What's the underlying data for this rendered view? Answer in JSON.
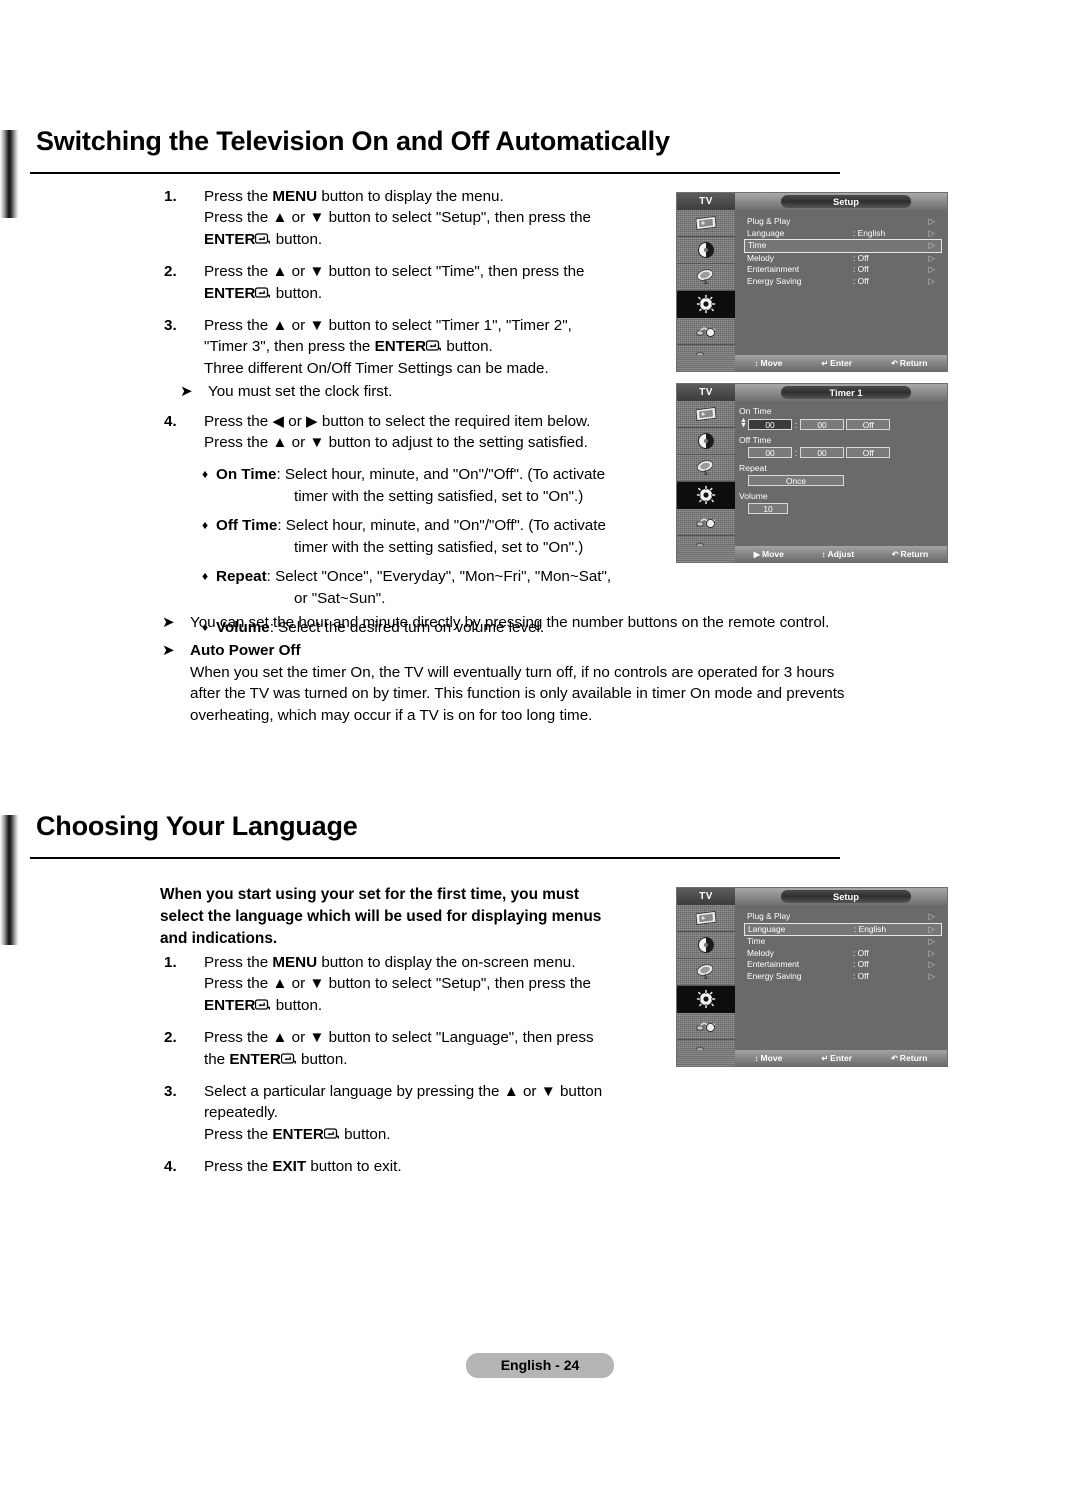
{
  "page": {
    "footer_label": "English - 24"
  },
  "section1": {
    "title": "Switching the Television On and Off Automatically",
    "steps": [
      {
        "num": "1.",
        "lines": [
          [
            {
              "t": "Press the "
            },
            {
              "t": "MENU",
              "b": true
            },
            {
              "t": " button to display the menu."
            }
          ],
          [
            {
              "t": "Press the ▲ or ▼ button to select \"Setup\", then press the"
            }
          ],
          [
            {
              "t": "ENTER",
              "b": true
            },
            {
              "t": "ENTERKEY",
              "icon": true
            },
            {
              "t": " button."
            }
          ]
        ]
      },
      {
        "num": "2.",
        "lines": [
          [
            {
              "t": "Press the ▲ or ▼ button to select \"Time\", then press the"
            }
          ],
          [
            {
              "t": "ENTER",
              "b": true
            },
            {
              "t": "ENTERKEY",
              "icon": true
            },
            {
              "t": " button."
            }
          ]
        ]
      },
      {
        "num": "3.",
        "lines": [
          [
            {
              "t": "Press the ▲ or ▼ button to select \"Timer 1\", \"Timer 2\","
            }
          ],
          [
            {
              "t": "\"Timer 3\", then press the "
            },
            {
              "t": "ENTER",
              "b": true
            },
            {
              "t": "ENTERKEY",
              "icon": true
            },
            {
              "t": " button."
            }
          ],
          [
            {
              "t": "Three different On/Off Timer Settings can be made."
            }
          ]
        ]
      }
    ],
    "note_clock": "You must set the clock first.",
    "step4": {
      "num": "4.",
      "lines": [
        [
          {
            "t": "Press the ◀ or ▶ button to select the required item below."
          }
        ],
        [
          {
            "t": "Press the ▲ or ▼ button to adjust to the setting satisfied."
          }
        ]
      ]
    },
    "bullets": [
      {
        "mark": "♦",
        "label": "On  Time",
        "rest": ": Select hour, minute, and \"On\"/\"Off\". (To activate",
        "cont": "timer with the setting satisfied, set to \"On\".)"
      },
      {
        "mark": "♦",
        "label": "Off  Time",
        "rest": ": Select hour, minute, and \"On\"/\"Off\". (To activate",
        "cont": "timer with the setting satisfied, set to \"On\".)"
      },
      {
        "mark": "♦",
        "label": "Repeat",
        "rest": ": Select \"Once\", \"Everyday\", \"Mon~Fri\", \"Mon~Sat\",",
        "cont": "or \"Sat~Sun\"."
      },
      {
        "mark": "♦",
        "label": "Volume",
        "rest": ": Select the desired turn on volume level.",
        "cont": ""
      }
    ],
    "note_numbers": "You can set the hour and minute directly by pressing the number buttons on the remote control.",
    "note_autopower_title": "Auto Power Off",
    "note_autopower_body": [
      "When you set the timer On, the TV will eventually turn off, if no controls are operated for 3 hours",
      "after the TV was turned on by timer. This function is only available in timer On mode and prevents",
      "overheating, which may occur if a TV is on for too long time."
    ]
  },
  "section2": {
    "title": "Choosing Your Language",
    "intro": [
      "When you start using your set for the first time, you must",
      "select the language which will be used for displaying menus",
      "and indications."
    ],
    "steps": [
      {
        "num": "1.",
        "lines": [
          [
            {
              "t": "Press the "
            },
            {
              "t": "MENU",
              "b": true
            },
            {
              "t": " button to display the on-screen menu."
            }
          ],
          [
            {
              "t": "Press the ▲ or ▼ button to select \"Setup\", then press the"
            }
          ],
          [
            {
              "t": "ENTER",
              "b": true
            },
            {
              "t": "ENTERKEY",
              "icon": true
            },
            {
              "t": " button."
            }
          ]
        ]
      },
      {
        "num": "2.",
        "lines": [
          [
            {
              "t": "Press the ▲ or ▼ button to select \"Language\", then press"
            }
          ],
          [
            {
              "t": "the "
            },
            {
              "t": "ENTER",
              "b": true
            },
            {
              "t": "ENTERKEY",
              "icon": true
            },
            {
              "t": " button."
            }
          ]
        ]
      },
      {
        "num": "3.",
        "lines": [
          [
            {
              "t": "Select a particular language by pressing the ▲ or ▼ button"
            }
          ],
          [
            {
              "t": "repeatedly."
            }
          ],
          [
            {
              "t": "Press the "
            },
            {
              "t": "ENTER",
              "b": true
            },
            {
              "t": "ENTERKEY",
              "icon": true
            },
            {
              "t": " button."
            }
          ]
        ]
      },
      {
        "num": "4.",
        "lines": [
          [
            {
              "t": "Press the "
            },
            {
              "t": "EXIT",
              "b": true
            },
            {
              "t": " button to exit."
            }
          ]
        ]
      }
    ]
  },
  "osd_setup_time": {
    "tv_label": "TV",
    "title": "Setup",
    "rows": [
      {
        "label": "Plug & Play",
        "value": "",
        "arrow": "▷",
        "selected": false
      },
      {
        "label": "Language",
        "value": ": English",
        "arrow": "▷",
        "selected": false
      },
      {
        "label": "Time",
        "value": "",
        "arrow": "▷",
        "selected": true
      },
      {
        "label": "Melody",
        "value": ": Off",
        "arrow": "▷",
        "selected": false
      },
      {
        "label": "Entertainment",
        "value": ": Off",
        "arrow": "▷",
        "selected": false
      },
      {
        "label": "Energy Saving",
        "value": ": Off",
        "arrow": "▷",
        "selected": false
      }
    ],
    "hints": [
      {
        "glyph": "↕",
        "label": "Move"
      },
      {
        "glyph": "↵",
        "label": "Enter"
      },
      {
        "glyph": "↶",
        "label": "Return"
      }
    ],
    "side_icons": [
      "picture-icon",
      "sound-icon",
      "channel-icon",
      "setup-icon",
      "input-icon",
      "pc-icon"
    ],
    "active_side_index": 3
  },
  "osd_setup_language": {
    "tv_label": "TV",
    "title": "Setup",
    "rows": [
      {
        "label": "Plug & Play",
        "value": "",
        "arrow": "▷",
        "selected": false
      },
      {
        "label": "Language",
        "value": ": English",
        "arrow": "▷",
        "selected": true
      },
      {
        "label": "Time",
        "value": "",
        "arrow": "▷",
        "selected": false
      },
      {
        "label": "Melody",
        "value": ": Off",
        "arrow": "▷",
        "selected": false
      },
      {
        "label": "Entertainment",
        "value": ": Off",
        "arrow": "▷",
        "selected": false
      },
      {
        "label": "Energy Saving",
        "value": ": Off",
        "arrow": "▷",
        "selected": false
      }
    ],
    "hints": [
      {
        "glyph": "↕",
        "label": "Move"
      },
      {
        "glyph": "↵",
        "label": "Enter"
      },
      {
        "glyph": "↶",
        "label": "Return"
      }
    ],
    "side_icons": [
      "picture-icon",
      "sound-icon",
      "channel-icon",
      "setup-icon",
      "input-icon",
      "pc-icon"
    ],
    "active_side_index": 3
  },
  "osd_timer1": {
    "tv_label": "TV",
    "title": "Timer 1",
    "on_time": {
      "label": "On Time",
      "hour": "00",
      "minute": "00",
      "state": "Off"
    },
    "off_time": {
      "label": "Off Time",
      "hour": "00",
      "minute": "00",
      "state": "Off"
    },
    "repeat": {
      "label": "Repeat",
      "value": "Once"
    },
    "volume": {
      "label": "Volume",
      "value": "10"
    },
    "hints": [
      {
        "glyph": "▶",
        "label": "Move"
      },
      {
        "glyph": "↕",
        "label": "Adjust"
      },
      {
        "glyph": "↶",
        "label": "Return"
      }
    ],
    "side_icons": [
      "picture-icon",
      "sound-icon",
      "channel-icon",
      "setup-icon",
      "input-icon",
      "pc-icon"
    ],
    "active_side_index": 3
  }
}
